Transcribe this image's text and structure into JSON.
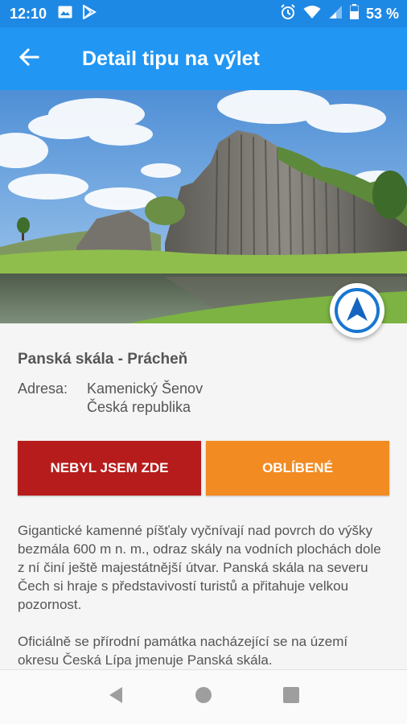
{
  "status_bar": {
    "time": "12:10",
    "battery": "53 %",
    "icons": [
      "gallery-icon",
      "play-store-icon",
      "alarm-icon",
      "wifi-icon",
      "signal-icon",
      "battery-icon"
    ]
  },
  "app_bar": {
    "back_icon": "arrow-back-icon",
    "title": "Detail tipu na výlet"
  },
  "hero": {
    "image": "rock-formation-photo",
    "navigate_icon": "navigation-arrow-icon"
  },
  "place": {
    "title": "Panská skála - Prácheň",
    "address_label": "Adresa:",
    "address_line1": "Kamenický Šenov",
    "address_line2": "Česká republika"
  },
  "buttons": {
    "not_visited": "NEBYL JSEM ZDE",
    "favorite": "OBLÍBENÉ"
  },
  "description": {
    "p1": "Gigantické kamenné píšťaly vyčnívají nad povrch do výšky bezmála 600 m n. m., odraz skály na vodních plochách dole z ní činí ještě majestátnější útvar. Panská skála na severu Čech si hraje s představivostí turistů a přitahuje velkou pozornost.",
    "p2": "Oficiálně se přírodní památka nacházející se na území okresu Česká Lípa jmenuje Panská skála."
  },
  "colors": {
    "status_bar": "#1e88e5",
    "app_bar": "#2196f3",
    "button_red": "#b71c1c",
    "button_orange": "#f28b22"
  },
  "nav_bar": {
    "icons": [
      "back-triangle-icon",
      "home-circle-icon",
      "recents-square-icon"
    ]
  }
}
